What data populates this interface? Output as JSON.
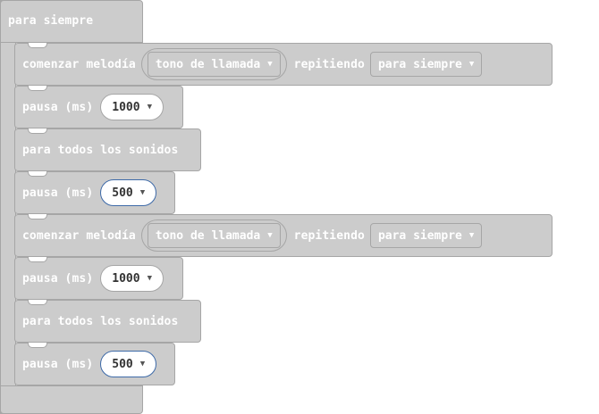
{
  "forever": {
    "label": "para siempre"
  },
  "blocks": [
    {
      "type": "melody",
      "label": "comenzar melodía",
      "melody": "tono de llamada",
      "repeat_label": "repitiendo",
      "repeat": "para siempre"
    },
    {
      "type": "pause",
      "label": "pausa (ms)",
      "value": "1000"
    },
    {
      "type": "stop",
      "label": "para todos los sonidos"
    },
    {
      "type": "pause",
      "label": "pausa (ms)",
      "value": "500"
    },
    {
      "type": "melody",
      "label": "comenzar melodía",
      "melody": "tono de llamada",
      "repeat_label": "repitiendo",
      "repeat": "para siempre"
    },
    {
      "type": "pause",
      "label": "pausa (ms)",
      "value": "1000"
    },
    {
      "type": "stop",
      "label": "para todos los sonidos"
    },
    {
      "type": "pause",
      "label": "pausa (ms)",
      "value": "500"
    }
  ],
  "icons": {
    "dropdown": "triangle-down-icon"
  },
  "colors": {
    "block": "#cccccc",
    "border": "#a6a6a6",
    "selected_outline": "#3e6aa8"
  }
}
